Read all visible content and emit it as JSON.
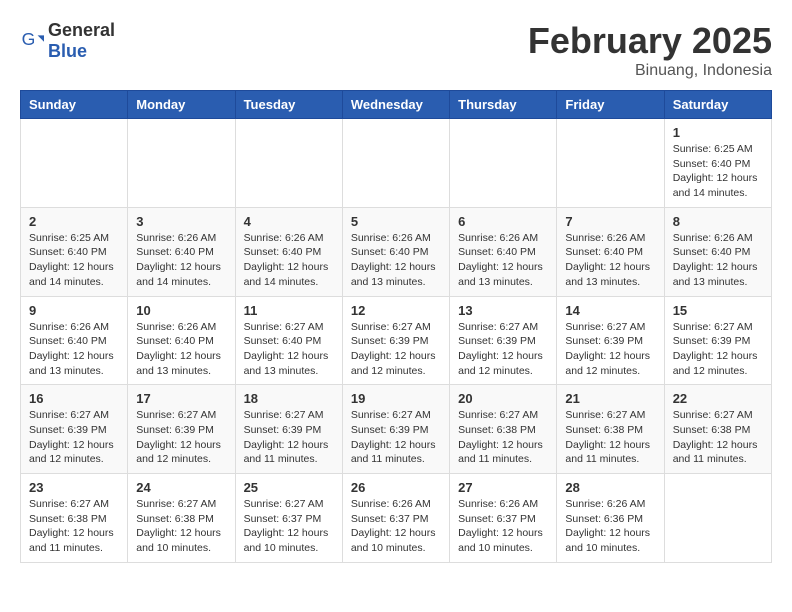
{
  "header": {
    "logo_general": "General",
    "logo_blue": "Blue",
    "month_title": "February 2025",
    "location": "Binuang, Indonesia"
  },
  "days_of_week": [
    "Sunday",
    "Monday",
    "Tuesday",
    "Wednesday",
    "Thursday",
    "Friday",
    "Saturday"
  ],
  "weeks": [
    [
      {
        "day": "",
        "info": ""
      },
      {
        "day": "",
        "info": ""
      },
      {
        "day": "",
        "info": ""
      },
      {
        "day": "",
        "info": ""
      },
      {
        "day": "",
        "info": ""
      },
      {
        "day": "",
        "info": ""
      },
      {
        "day": "1",
        "info": "Sunrise: 6:25 AM\nSunset: 6:40 PM\nDaylight: 12 hours\nand 14 minutes."
      }
    ],
    [
      {
        "day": "2",
        "info": "Sunrise: 6:25 AM\nSunset: 6:40 PM\nDaylight: 12 hours\nand 14 minutes."
      },
      {
        "day": "3",
        "info": "Sunrise: 6:26 AM\nSunset: 6:40 PM\nDaylight: 12 hours\nand 14 minutes."
      },
      {
        "day": "4",
        "info": "Sunrise: 6:26 AM\nSunset: 6:40 PM\nDaylight: 12 hours\nand 14 minutes."
      },
      {
        "day": "5",
        "info": "Sunrise: 6:26 AM\nSunset: 6:40 PM\nDaylight: 12 hours\nand 13 minutes."
      },
      {
        "day": "6",
        "info": "Sunrise: 6:26 AM\nSunset: 6:40 PM\nDaylight: 12 hours\nand 13 minutes."
      },
      {
        "day": "7",
        "info": "Sunrise: 6:26 AM\nSunset: 6:40 PM\nDaylight: 12 hours\nand 13 minutes."
      },
      {
        "day": "8",
        "info": "Sunrise: 6:26 AM\nSunset: 6:40 PM\nDaylight: 12 hours\nand 13 minutes."
      }
    ],
    [
      {
        "day": "9",
        "info": "Sunrise: 6:26 AM\nSunset: 6:40 PM\nDaylight: 12 hours\nand 13 minutes."
      },
      {
        "day": "10",
        "info": "Sunrise: 6:26 AM\nSunset: 6:40 PM\nDaylight: 12 hours\nand 13 minutes."
      },
      {
        "day": "11",
        "info": "Sunrise: 6:27 AM\nSunset: 6:40 PM\nDaylight: 12 hours\nand 13 minutes."
      },
      {
        "day": "12",
        "info": "Sunrise: 6:27 AM\nSunset: 6:39 PM\nDaylight: 12 hours\nand 12 minutes."
      },
      {
        "day": "13",
        "info": "Sunrise: 6:27 AM\nSunset: 6:39 PM\nDaylight: 12 hours\nand 12 minutes."
      },
      {
        "day": "14",
        "info": "Sunrise: 6:27 AM\nSunset: 6:39 PM\nDaylight: 12 hours\nand 12 minutes."
      },
      {
        "day": "15",
        "info": "Sunrise: 6:27 AM\nSunset: 6:39 PM\nDaylight: 12 hours\nand 12 minutes."
      }
    ],
    [
      {
        "day": "16",
        "info": "Sunrise: 6:27 AM\nSunset: 6:39 PM\nDaylight: 12 hours\nand 12 minutes."
      },
      {
        "day": "17",
        "info": "Sunrise: 6:27 AM\nSunset: 6:39 PM\nDaylight: 12 hours\nand 12 minutes."
      },
      {
        "day": "18",
        "info": "Sunrise: 6:27 AM\nSunset: 6:39 PM\nDaylight: 12 hours\nand 11 minutes."
      },
      {
        "day": "19",
        "info": "Sunrise: 6:27 AM\nSunset: 6:39 PM\nDaylight: 12 hours\nand 11 minutes."
      },
      {
        "day": "20",
        "info": "Sunrise: 6:27 AM\nSunset: 6:38 PM\nDaylight: 12 hours\nand 11 minutes."
      },
      {
        "day": "21",
        "info": "Sunrise: 6:27 AM\nSunset: 6:38 PM\nDaylight: 12 hours\nand 11 minutes."
      },
      {
        "day": "22",
        "info": "Sunrise: 6:27 AM\nSunset: 6:38 PM\nDaylight: 12 hours\nand 11 minutes."
      }
    ],
    [
      {
        "day": "23",
        "info": "Sunrise: 6:27 AM\nSunset: 6:38 PM\nDaylight: 12 hours\nand 11 minutes."
      },
      {
        "day": "24",
        "info": "Sunrise: 6:27 AM\nSunset: 6:38 PM\nDaylight: 12 hours\nand 10 minutes."
      },
      {
        "day": "25",
        "info": "Sunrise: 6:27 AM\nSunset: 6:37 PM\nDaylight: 12 hours\nand 10 minutes."
      },
      {
        "day": "26",
        "info": "Sunrise: 6:26 AM\nSunset: 6:37 PM\nDaylight: 12 hours\nand 10 minutes."
      },
      {
        "day": "27",
        "info": "Sunrise: 6:26 AM\nSunset: 6:37 PM\nDaylight: 12 hours\nand 10 minutes."
      },
      {
        "day": "28",
        "info": "Sunrise: 6:26 AM\nSunset: 6:36 PM\nDaylight: 12 hours\nand 10 minutes."
      },
      {
        "day": "",
        "info": ""
      }
    ]
  ]
}
